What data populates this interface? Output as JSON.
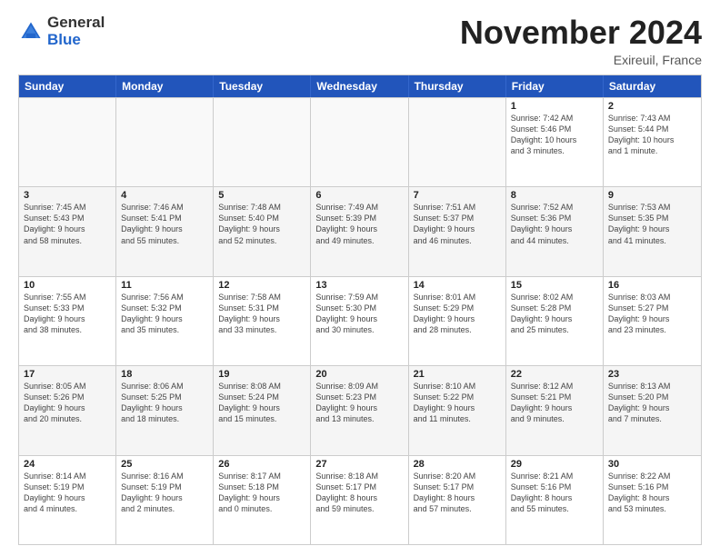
{
  "logo": {
    "general": "General",
    "blue": "Blue"
  },
  "header": {
    "month": "November 2024",
    "location": "Exireuil, France"
  },
  "days": [
    "Sunday",
    "Monday",
    "Tuesday",
    "Wednesday",
    "Thursday",
    "Friday",
    "Saturday"
  ],
  "rows": [
    [
      {
        "day": "",
        "info": ""
      },
      {
        "day": "",
        "info": ""
      },
      {
        "day": "",
        "info": ""
      },
      {
        "day": "",
        "info": ""
      },
      {
        "day": "",
        "info": ""
      },
      {
        "day": "1",
        "info": "Sunrise: 7:42 AM\nSunset: 5:46 PM\nDaylight: 10 hours\nand 3 minutes."
      },
      {
        "day": "2",
        "info": "Sunrise: 7:43 AM\nSunset: 5:44 PM\nDaylight: 10 hours\nand 1 minute."
      }
    ],
    [
      {
        "day": "3",
        "info": "Sunrise: 7:45 AM\nSunset: 5:43 PM\nDaylight: 9 hours\nand 58 minutes."
      },
      {
        "day": "4",
        "info": "Sunrise: 7:46 AM\nSunset: 5:41 PM\nDaylight: 9 hours\nand 55 minutes."
      },
      {
        "day": "5",
        "info": "Sunrise: 7:48 AM\nSunset: 5:40 PM\nDaylight: 9 hours\nand 52 minutes."
      },
      {
        "day": "6",
        "info": "Sunrise: 7:49 AM\nSunset: 5:39 PM\nDaylight: 9 hours\nand 49 minutes."
      },
      {
        "day": "7",
        "info": "Sunrise: 7:51 AM\nSunset: 5:37 PM\nDaylight: 9 hours\nand 46 minutes."
      },
      {
        "day": "8",
        "info": "Sunrise: 7:52 AM\nSunset: 5:36 PM\nDaylight: 9 hours\nand 44 minutes."
      },
      {
        "day": "9",
        "info": "Sunrise: 7:53 AM\nSunset: 5:35 PM\nDaylight: 9 hours\nand 41 minutes."
      }
    ],
    [
      {
        "day": "10",
        "info": "Sunrise: 7:55 AM\nSunset: 5:33 PM\nDaylight: 9 hours\nand 38 minutes."
      },
      {
        "day": "11",
        "info": "Sunrise: 7:56 AM\nSunset: 5:32 PM\nDaylight: 9 hours\nand 35 minutes."
      },
      {
        "day": "12",
        "info": "Sunrise: 7:58 AM\nSunset: 5:31 PM\nDaylight: 9 hours\nand 33 minutes."
      },
      {
        "day": "13",
        "info": "Sunrise: 7:59 AM\nSunset: 5:30 PM\nDaylight: 9 hours\nand 30 minutes."
      },
      {
        "day": "14",
        "info": "Sunrise: 8:01 AM\nSunset: 5:29 PM\nDaylight: 9 hours\nand 28 minutes."
      },
      {
        "day": "15",
        "info": "Sunrise: 8:02 AM\nSunset: 5:28 PM\nDaylight: 9 hours\nand 25 minutes."
      },
      {
        "day": "16",
        "info": "Sunrise: 8:03 AM\nSunset: 5:27 PM\nDaylight: 9 hours\nand 23 minutes."
      }
    ],
    [
      {
        "day": "17",
        "info": "Sunrise: 8:05 AM\nSunset: 5:26 PM\nDaylight: 9 hours\nand 20 minutes."
      },
      {
        "day": "18",
        "info": "Sunrise: 8:06 AM\nSunset: 5:25 PM\nDaylight: 9 hours\nand 18 minutes."
      },
      {
        "day": "19",
        "info": "Sunrise: 8:08 AM\nSunset: 5:24 PM\nDaylight: 9 hours\nand 15 minutes."
      },
      {
        "day": "20",
        "info": "Sunrise: 8:09 AM\nSunset: 5:23 PM\nDaylight: 9 hours\nand 13 minutes."
      },
      {
        "day": "21",
        "info": "Sunrise: 8:10 AM\nSunset: 5:22 PM\nDaylight: 9 hours\nand 11 minutes."
      },
      {
        "day": "22",
        "info": "Sunrise: 8:12 AM\nSunset: 5:21 PM\nDaylight: 9 hours\nand 9 minutes."
      },
      {
        "day": "23",
        "info": "Sunrise: 8:13 AM\nSunset: 5:20 PM\nDaylight: 9 hours\nand 7 minutes."
      }
    ],
    [
      {
        "day": "24",
        "info": "Sunrise: 8:14 AM\nSunset: 5:19 PM\nDaylight: 9 hours\nand 4 minutes."
      },
      {
        "day": "25",
        "info": "Sunrise: 8:16 AM\nSunset: 5:19 PM\nDaylight: 9 hours\nand 2 minutes."
      },
      {
        "day": "26",
        "info": "Sunrise: 8:17 AM\nSunset: 5:18 PM\nDaylight: 9 hours\nand 0 minutes."
      },
      {
        "day": "27",
        "info": "Sunrise: 8:18 AM\nSunset: 5:17 PM\nDaylight: 8 hours\nand 59 minutes."
      },
      {
        "day": "28",
        "info": "Sunrise: 8:20 AM\nSunset: 5:17 PM\nDaylight: 8 hours\nand 57 minutes."
      },
      {
        "day": "29",
        "info": "Sunrise: 8:21 AM\nSunset: 5:16 PM\nDaylight: 8 hours\nand 55 minutes."
      },
      {
        "day": "30",
        "info": "Sunrise: 8:22 AM\nSunset: 5:16 PM\nDaylight: 8 hours\nand 53 minutes."
      }
    ]
  ]
}
